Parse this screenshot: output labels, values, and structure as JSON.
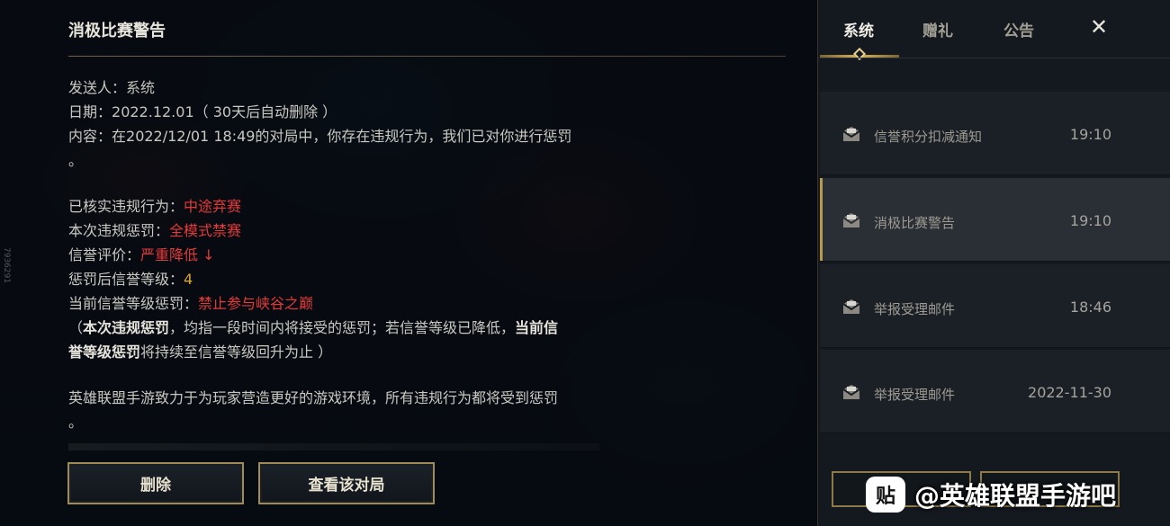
{
  "mail": {
    "title": "消极比赛警告",
    "sender_label": "发送人：",
    "sender": "系统",
    "date_label": "日期：",
    "date": "2022.12.01",
    "date_note": "（ 30天后自动删除 ）",
    "content_label": "内容：",
    "content_line1": "在2022/12/01 18:49的对局中，你存在违规行为，我们已对你进行惩罚",
    "content_line2": "。",
    "verified_label": "已核实违规行为：",
    "verified_value": "中途弃赛",
    "penalty_label": "本次违规惩罚：",
    "penalty_value": "全模式禁赛",
    "credit_eval_label": "信誉评价：",
    "credit_eval_value": "严重降低 ↓",
    "credit_level_label": "惩罚后信誉等级：",
    "credit_level_value": "4",
    "current_penalty_label": "当前信誉等级惩罚：",
    "current_penalty_value": "禁止参与峡谷之巅",
    "note_open": "（",
    "note_bold1": "本次违规惩罚",
    "note_mid": "，均指一段时间内将接受的惩罚；若信誉等级已降低，",
    "note_bold2a": "当前信",
    "note_bold2b": "誉等级惩罚",
    "note_end": "将持续至信誉等级回升为止 ）",
    "closing_line1": "英雄联盟手游致力于为玩家营造更好的游戏环境，所有违规行为都将受到惩罚",
    "closing_line2": "。"
  },
  "buttons": {
    "delete": "删除",
    "view_match": "查看该对局"
  },
  "side_watermark": "7936291",
  "tabs": {
    "system": "系统",
    "gift": "赠礼",
    "notice": "公告",
    "close": "✕"
  },
  "mail_list": [
    {
      "title": "信誉积分扣减通知",
      "time": "19:10"
    },
    {
      "title": "消极比赛警告",
      "time": "19:10"
    },
    {
      "title": "举报受理邮件",
      "time": "18:46"
    },
    {
      "title": "举报受理邮件",
      "time": "2022-11-30"
    }
  ],
  "watermark": {
    "logo": "贴",
    "text": "@英雄联盟手游吧"
  },
  "colors": {
    "accent_gold": "#b89a4e",
    "violation_red": "#e23a3a",
    "level_gold": "#d7a437"
  }
}
